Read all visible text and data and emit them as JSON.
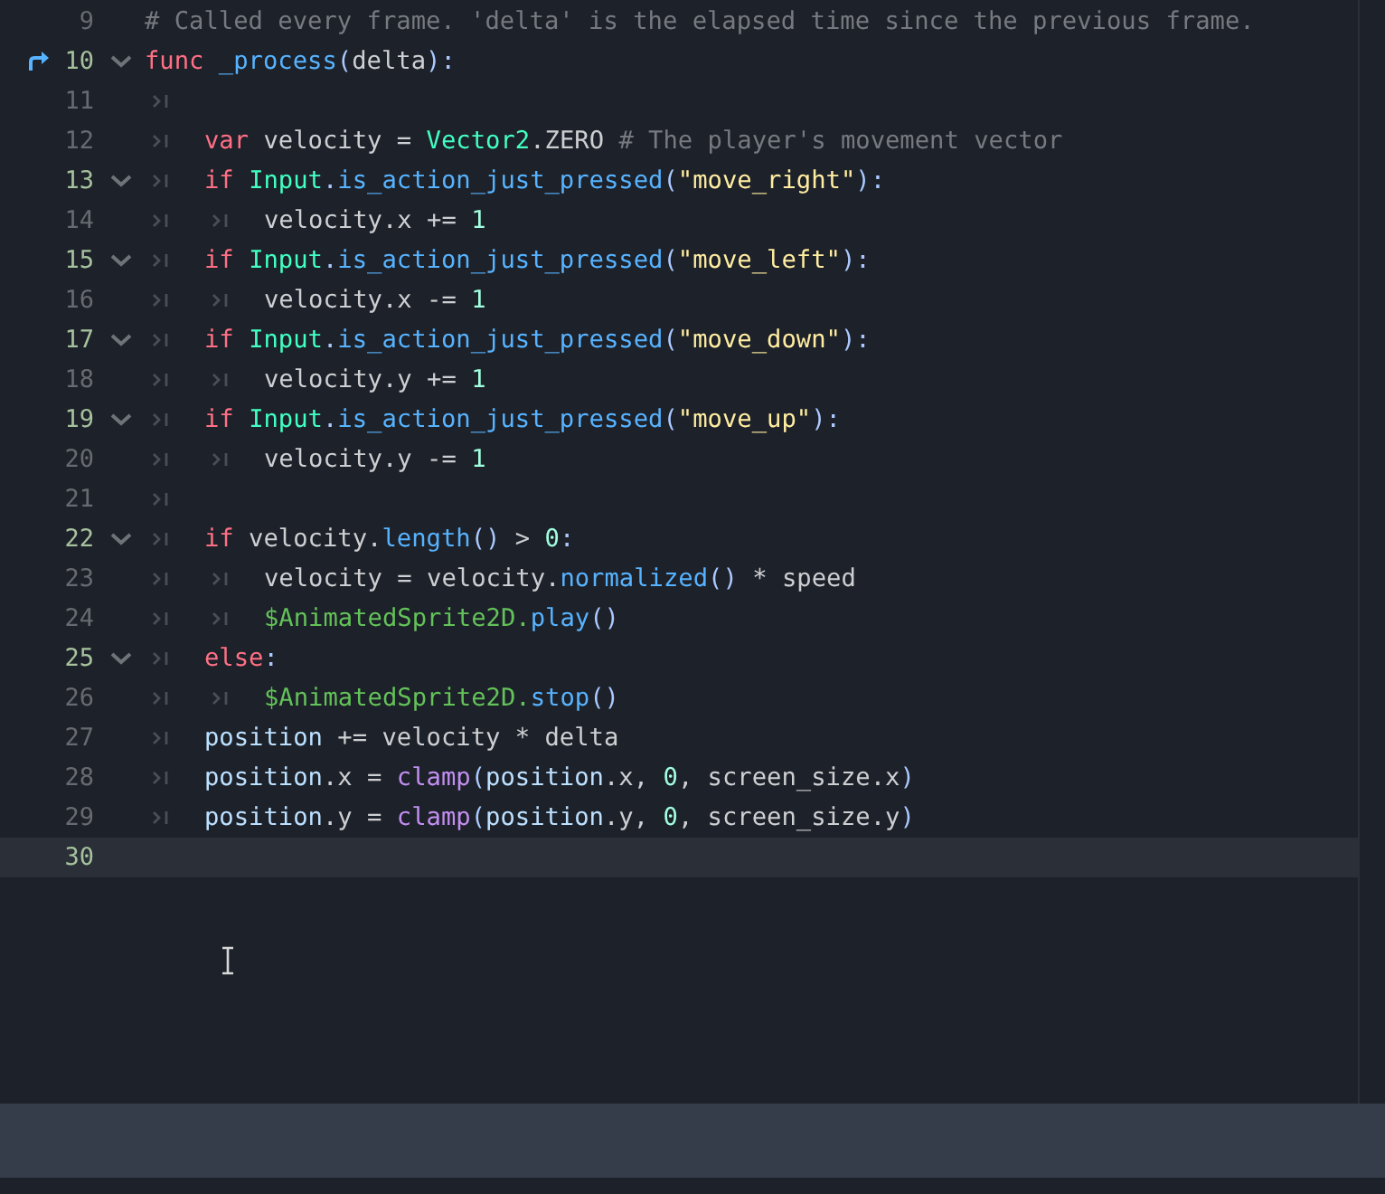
{
  "editor": {
    "lines": [
      {
        "number": "9",
        "foldable": false,
        "current": false,
        "override": false,
        "tokens": [
          {
            "kind": "cmt",
            "text": "# Called every frame. 'delta' is the elapsed time since the previous frame."
          }
        ]
      },
      {
        "number": "10",
        "foldable": true,
        "current": false,
        "override": true,
        "tokens": [
          {
            "kind": "kw",
            "text": "func "
          },
          {
            "kind": "fn",
            "text": "_process"
          },
          {
            "kind": "sym",
            "text": "("
          },
          {
            "kind": "txt",
            "text": "delta"
          },
          {
            "kind": "sym",
            "text": "):"
          }
        ]
      },
      {
        "number": "11",
        "foldable": false,
        "current": false,
        "override": false,
        "tab_markers": [
          {
            "kind": "tab"
          }
        ]
      },
      {
        "number": "12",
        "foldable": false,
        "current": false,
        "override": false,
        "tab_markers": [
          {
            "kind": "tab"
          }
        ],
        "tokens": [
          {
            "kind": "kw",
            "text": "var"
          },
          {
            "kind": "txt",
            "text": " velocity = "
          },
          {
            "kind": "type",
            "text": "Vector2"
          },
          {
            "kind": "txt",
            "text": ".ZERO "
          },
          {
            "kind": "cmt",
            "text": "# The player's movement vector"
          }
        ]
      },
      {
        "number": "13",
        "foldable": true,
        "current": false,
        "override": false,
        "tab_markers": [
          {
            "kind": "tab"
          }
        ],
        "tokens": [
          {
            "kind": "kw",
            "text": "if "
          },
          {
            "kind": "type",
            "text": "Input"
          },
          {
            "kind": "sym",
            "text": "."
          },
          {
            "kind": "call",
            "text": "is_action_just_pressed"
          },
          {
            "kind": "sym",
            "text": "("
          },
          {
            "kind": "str",
            "text": "\"move_right\""
          },
          {
            "kind": "sym",
            "text": "):"
          }
        ]
      },
      {
        "number": "14",
        "foldable": false,
        "current": false,
        "override": false,
        "tab_markers": [
          {
            "kind": "tab"
          },
          {
            "kind": "tab"
          }
        ],
        "tokens": [
          {
            "kind": "txt",
            "text": "velocity.x += "
          },
          {
            "kind": "num",
            "text": "1"
          }
        ]
      },
      {
        "number": "15",
        "foldable": true,
        "current": false,
        "override": false,
        "tab_markers": [
          {
            "kind": "tab"
          }
        ],
        "tokens": [
          {
            "kind": "kw",
            "text": "if "
          },
          {
            "kind": "type",
            "text": "Input"
          },
          {
            "kind": "sym",
            "text": "."
          },
          {
            "kind": "call",
            "text": "is_action_just_pressed"
          },
          {
            "kind": "sym",
            "text": "("
          },
          {
            "kind": "str",
            "text": "\"move_left\""
          },
          {
            "kind": "sym",
            "text": "):"
          }
        ]
      },
      {
        "number": "16",
        "foldable": false,
        "current": false,
        "override": false,
        "tab_markers": [
          {
            "kind": "tab"
          },
          {
            "kind": "tab"
          }
        ],
        "tokens": [
          {
            "kind": "txt",
            "text": "velocity.x -= "
          },
          {
            "kind": "num",
            "text": "1"
          }
        ]
      },
      {
        "number": "17",
        "foldable": true,
        "current": false,
        "override": false,
        "tab_markers": [
          {
            "kind": "tab"
          }
        ],
        "tokens": [
          {
            "kind": "kw",
            "text": "if "
          },
          {
            "kind": "type",
            "text": "Input"
          },
          {
            "kind": "sym",
            "text": "."
          },
          {
            "kind": "call",
            "text": "is_action_just_pressed"
          },
          {
            "kind": "sym",
            "text": "("
          },
          {
            "kind": "str",
            "text": "\"move_down\""
          },
          {
            "kind": "sym",
            "text": "):"
          }
        ]
      },
      {
        "number": "18",
        "foldable": false,
        "current": false,
        "override": false,
        "tab_markers": [
          {
            "kind": "tab"
          },
          {
            "kind": "tab"
          }
        ],
        "tokens": [
          {
            "kind": "txt",
            "text": "velocity.y += "
          },
          {
            "kind": "num",
            "text": "1"
          }
        ]
      },
      {
        "number": "19",
        "foldable": true,
        "current": false,
        "override": false,
        "tab_markers": [
          {
            "kind": "tab"
          }
        ],
        "tokens": [
          {
            "kind": "kw",
            "text": "if "
          },
          {
            "kind": "type",
            "text": "Input"
          },
          {
            "kind": "sym",
            "text": "."
          },
          {
            "kind": "call",
            "text": "is_action_just_pressed"
          },
          {
            "kind": "sym",
            "text": "("
          },
          {
            "kind": "str",
            "text": "\"move_up\""
          },
          {
            "kind": "sym",
            "text": "):"
          }
        ]
      },
      {
        "number": "20",
        "foldable": false,
        "current": false,
        "override": false,
        "tab_markers": [
          {
            "kind": "tab"
          },
          {
            "kind": "tab"
          }
        ],
        "tokens": [
          {
            "kind": "txt",
            "text": "velocity.y -= "
          },
          {
            "kind": "num",
            "text": "1"
          }
        ]
      },
      {
        "number": "21",
        "foldable": false,
        "current": false,
        "override": false,
        "tab_markers": [
          {
            "kind": "tab"
          }
        ]
      },
      {
        "number": "22",
        "foldable": true,
        "current": false,
        "override": false,
        "tab_markers": [
          {
            "kind": "tab"
          }
        ],
        "tokens": [
          {
            "kind": "kw",
            "text": "if"
          },
          {
            "kind": "txt",
            "text": " velocity."
          },
          {
            "kind": "call",
            "text": "length"
          },
          {
            "kind": "sym",
            "text": "()"
          },
          {
            "kind": "txt",
            "text": " > "
          },
          {
            "kind": "num",
            "text": "0"
          },
          {
            "kind": "sym",
            "text": ":"
          }
        ]
      },
      {
        "number": "23",
        "foldable": false,
        "current": false,
        "override": false,
        "tab_markers": [
          {
            "kind": "tab"
          },
          {
            "kind": "tab"
          }
        ],
        "tokens": [
          {
            "kind": "txt",
            "text": "velocity = velocity."
          },
          {
            "kind": "call",
            "text": "normalized"
          },
          {
            "kind": "sym",
            "text": "()"
          },
          {
            "kind": "txt",
            "text": " * speed"
          }
        ]
      },
      {
        "number": "24",
        "foldable": false,
        "current": false,
        "override": false,
        "tab_markers": [
          {
            "kind": "tab"
          },
          {
            "kind": "tab"
          }
        ],
        "tokens": [
          {
            "kind": "node",
            "text": "$AnimatedSprite2D."
          },
          {
            "kind": "call",
            "text": "play"
          },
          {
            "kind": "sym",
            "text": "()"
          }
        ]
      },
      {
        "number": "25",
        "foldable": true,
        "current": false,
        "override": false,
        "tab_markers": [
          {
            "kind": "tab"
          }
        ],
        "tokens": [
          {
            "kind": "kw",
            "text": "else"
          },
          {
            "kind": "sym",
            "text": ":"
          }
        ]
      },
      {
        "number": "26",
        "foldable": false,
        "current": false,
        "override": false,
        "tab_markers": [
          {
            "kind": "tab"
          },
          {
            "kind": "tab"
          }
        ],
        "tokens": [
          {
            "kind": "node",
            "text": "$AnimatedSprite2D."
          },
          {
            "kind": "call",
            "text": "stop"
          },
          {
            "kind": "sym",
            "text": "()"
          }
        ]
      },
      {
        "number": "27",
        "foldable": false,
        "current": false,
        "override": false,
        "tab_markers": [
          {
            "kind": "tab"
          }
        ],
        "tokens": [
          {
            "kind": "mem",
            "text": "position"
          },
          {
            "kind": "txt",
            "text": " += velocity * delta"
          }
        ]
      },
      {
        "number": "28",
        "foldable": false,
        "current": false,
        "override": false,
        "tab_markers": [
          {
            "kind": "tab"
          }
        ],
        "tokens": [
          {
            "kind": "mem",
            "text": "position"
          },
          {
            "kind": "txt",
            "text": ".x = "
          },
          {
            "kind": "util",
            "text": "clamp"
          },
          {
            "kind": "sym",
            "text": "("
          },
          {
            "kind": "mem",
            "text": "position"
          },
          {
            "kind": "txt",
            "text": ".x, "
          },
          {
            "kind": "num",
            "text": "0"
          },
          {
            "kind": "txt",
            "text": ", screen_size.x"
          },
          {
            "kind": "sym",
            "text": ")"
          }
        ]
      },
      {
        "number": "29",
        "foldable": false,
        "current": false,
        "override": false,
        "tab_markers": [
          {
            "kind": "tab"
          }
        ],
        "tokens": [
          {
            "kind": "mem",
            "text": "position"
          },
          {
            "kind": "txt",
            "text": ".y = "
          },
          {
            "kind": "util",
            "text": "clamp"
          },
          {
            "kind": "sym",
            "text": "("
          },
          {
            "kind": "mem",
            "text": "position"
          },
          {
            "kind": "txt",
            "text": ".y, "
          },
          {
            "kind": "num",
            "text": "0"
          },
          {
            "kind": "txt",
            "text": ", screen_size.y"
          },
          {
            "kind": "sym",
            "text": ")"
          }
        ]
      },
      {
        "number": "30",
        "foldable": false,
        "current": true,
        "override": false
      }
    ]
  }
}
